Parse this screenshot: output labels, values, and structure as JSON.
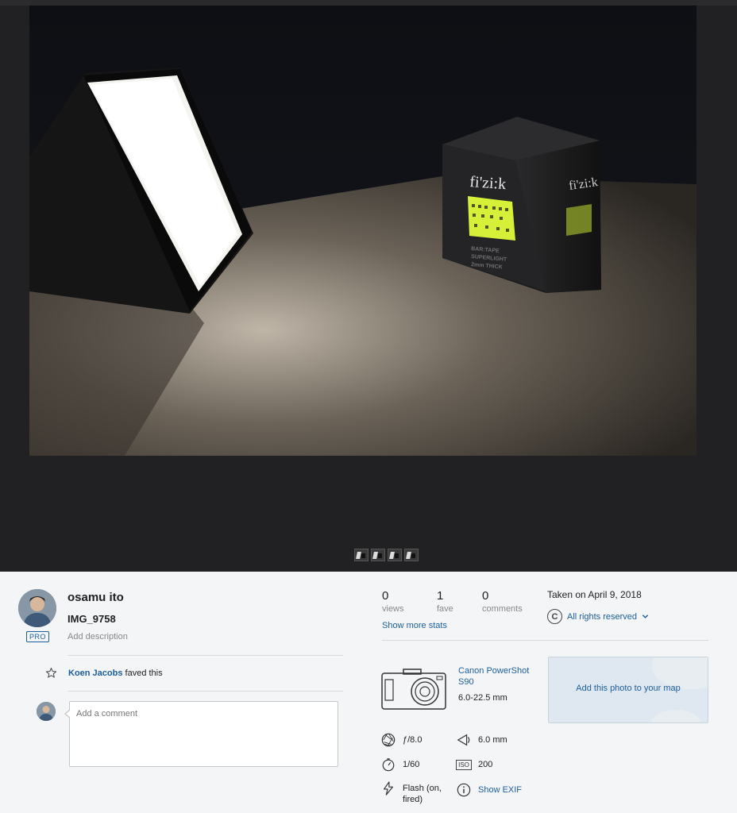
{
  "photo": {
    "box_brand": "fi'zi:k",
    "box_side_brand": "fi'zi:k",
    "box_text": [
      "BAR:TAPE",
      "SUPERLIGHT",
      "2mm THICK"
    ],
    "thumbnails": [
      "thumb-1",
      "thumb-2",
      "thumb-3",
      "thumb-4"
    ]
  },
  "owner": {
    "name": "osamu ito",
    "badge": "PRO"
  },
  "photo_info": {
    "title": "IMG_9758",
    "add_description": "Add description"
  },
  "faves": {
    "user": "Koen Jacobs",
    "text": "faved this"
  },
  "comment": {
    "placeholder": "Add a comment"
  },
  "stats": {
    "views_count": "0",
    "views_label": "views",
    "faves_count": "1",
    "faves_label": "fave",
    "comments_count": "0",
    "comments_label": "comments",
    "more": "Show more stats"
  },
  "meta": {
    "taken": "Taken on April 9, 2018",
    "license": "All rights reserved"
  },
  "camera": {
    "name": "Canon PowerShot S90",
    "lens": "6.0-22.5 mm"
  },
  "map": {
    "label": "Add this photo to your map"
  },
  "exif": {
    "aperture": "ƒ/8.0",
    "focal_length": "6.0 mm",
    "shutter": "1/60",
    "iso_label": "ISO",
    "iso": "200",
    "flash": "Flash (on, fired)",
    "show_exif": "Show EXIF"
  },
  "colors": {
    "viewer_bg": "#212124",
    "info_bg": "#f3f5f6",
    "link": "#1c5e9c",
    "muted": "#898989",
    "box_label": "#d6f03a"
  }
}
